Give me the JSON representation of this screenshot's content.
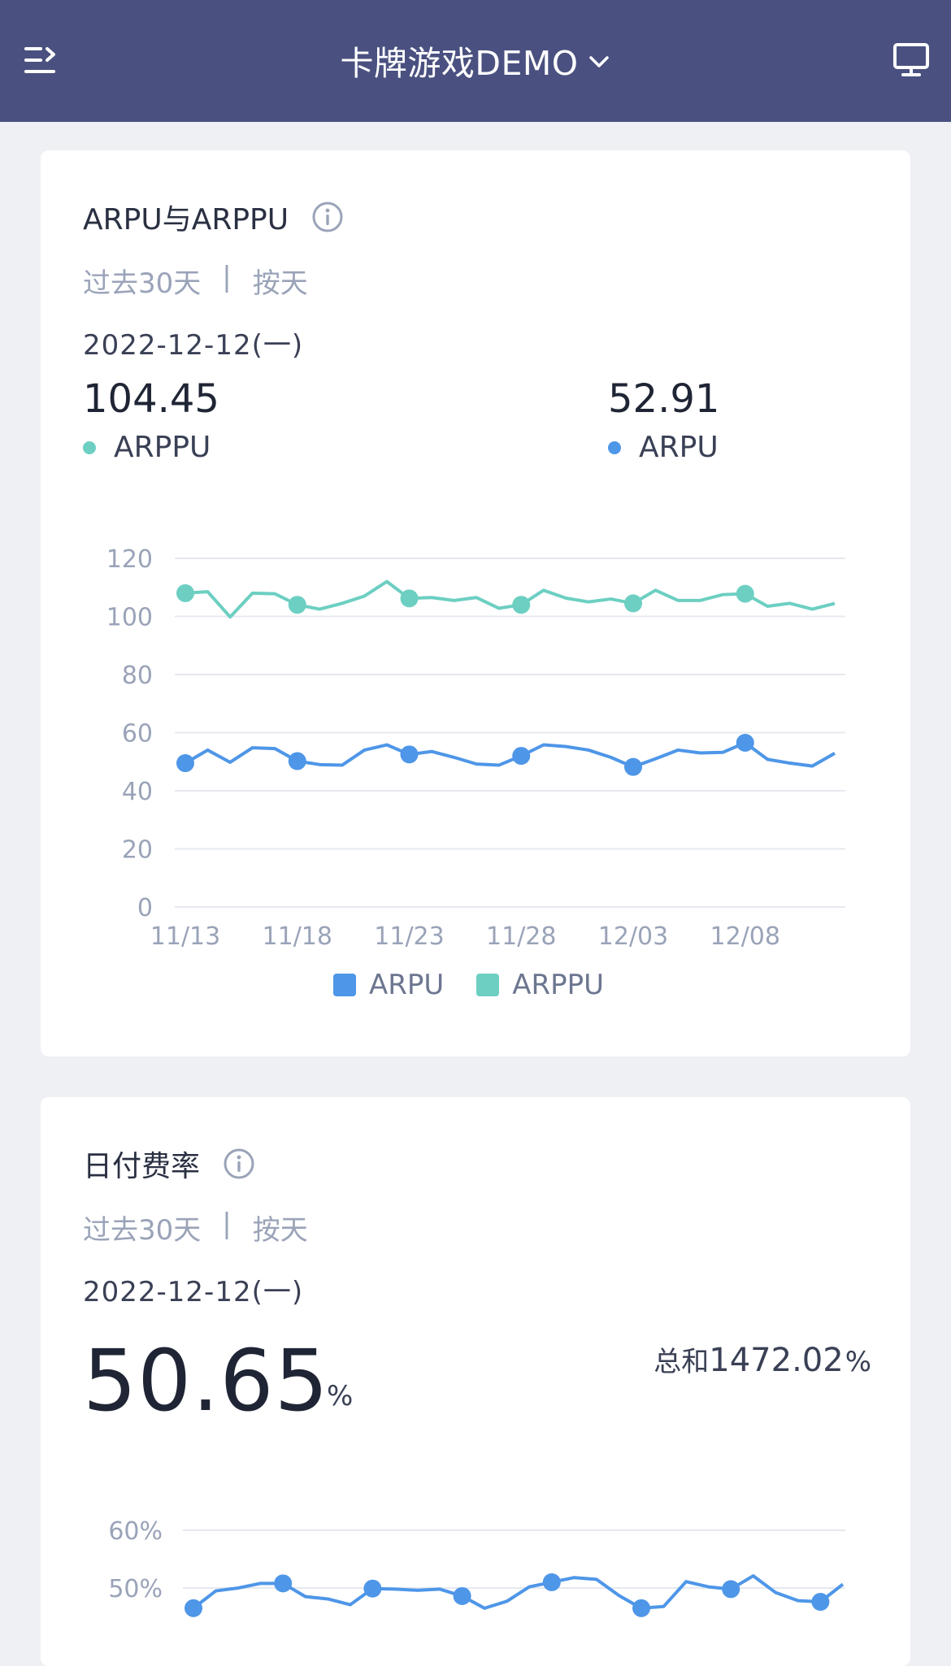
{
  "header": {
    "title": "卡牌游戏DEMO",
    "menu_icon": "menu-icon",
    "dropdown_icon": "chevron-down-icon",
    "monitor_icon": "monitor-icon",
    "background": "#4a5180"
  },
  "colors": {
    "arpu": "#4e96e8",
    "arppu": "#6ccfc2"
  },
  "card_arpu": {
    "title": "ARPU与ARPPU",
    "period": "过去30天",
    "separator": "|",
    "granularity": "按天",
    "date": "2022-12-12(一)",
    "metrics": [
      {
        "value": "104.45",
        "label": "ARPPU"
      },
      {
        "value": "52.91",
        "label": "ARPU"
      }
    ],
    "chart_data": {
      "type": "line",
      "xlabel": "",
      "ylabel": "",
      "ylim": [
        0,
        120
      ],
      "yticks": [
        "0",
        "20",
        "40",
        "60",
        "80",
        "100",
        "120"
      ],
      "x_tick_labels": [
        "11/13",
        "11/18",
        "11/23",
        "11/28",
        "12/03",
        "12/08"
      ],
      "x": [
        "11/13",
        "11/14",
        "11/15",
        "11/16",
        "11/17",
        "11/18",
        "11/19",
        "11/20",
        "11/21",
        "11/22",
        "11/23",
        "11/24",
        "11/25",
        "11/26",
        "11/27",
        "11/28",
        "11/29",
        "11/30",
        "12/01",
        "12/02",
        "12/03",
        "12/04",
        "12/05",
        "12/06",
        "12/07",
        "12/08",
        "12/09",
        "12/10",
        "12/11",
        "12/12"
      ],
      "legend": [
        "ARPU",
        "ARPPU"
      ],
      "legend_position": "bottom",
      "series": [
        {
          "name": "ARPU",
          "values": [
            49.5,
            54,
            49.8,
            54.8,
            54.5,
            50.2,
            49,
            48.8,
            54,
            55.8,
            52.5,
            53.5,
            51.5,
            49.2,
            48.8,
            52,
            55.8,
            55.2,
            54,
            51.5,
            48.2,
            51,
            54,
            53,
            53.2,
            56.5,
            50.8,
            49.5,
            48.5,
            52.9
          ]
        },
        {
          "name": "ARPPU",
          "values": [
            108,
            108.5,
            99.8,
            108,
            107.8,
            104,
            102.5,
            104.5,
            107,
            112,
            106.2,
            106.5,
            105.5,
            106.5,
            102.8,
            104,
            109,
            106.3,
            105,
            106,
            104.5,
            109,
            105.5,
            105.5,
            107.5,
            107.8,
            103.5,
            104.5,
            102.5,
            104.45
          ]
        }
      ]
    }
  },
  "card_rate": {
    "title": "日付费率",
    "period": "过去30天",
    "separator": "|",
    "granularity": "按天",
    "date": "2022-12-12(一)",
    "value": "50.65",
    "unit": "%",
    "sum_label": "总和",
    "sum_value": "1472.02",
    "sum_unit": "%",
    "chart_data": {
      "type": "line",
      "yticks": [
        "60%",
        "50%"
      ],
      "ylim_visible": [
        46,
        60
      ],
      "series": [
        {
          "name": "日付费率",
          "values": [
            46.5,
            49.5,
            50,
            50.8,
            50.8,
            48.5,
            48.1,
            47.1,
            49.9,
            49.8,
            49.6,
            49.8,
            48.6,
            46.5,
            47.7,
            50.2,
            51,
            51.8,
            51.5,
            48.7,
            46.5,
            46.8,
            51.1,
            50.2,
            49.8,
            52.1,
            49.2,
            47.8,
            47.6,
            50.65
          ]
        }
      ]
    }
  }
}
